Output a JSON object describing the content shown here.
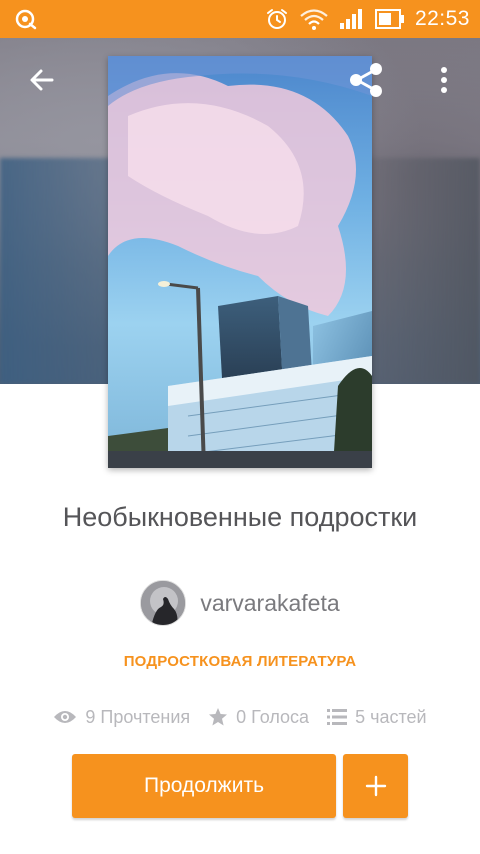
{
  "status_bar": {
    "time": "22:53",
    "icons": [
      "sync-icon",
      "alarm-icon",
      "wifi-icon",
      "signal-icon",
      "battery-icon"
    ],
    "color": "#f6921e"
  },
  "toolbar": {
    "icons": [
      "back-arrow-icon",
      "share-icon",
      "more-vert-icon"
    ]
  },
  "story": {
    "title": "Необыкновенные подростки",
    "author": "varvarakafeta",
    "category": "ПОДРОСТКОВАЯ ЛИТЕРАТУРА",
    "stats": {
      "reads": "9 Прочтения",
      "votes": "0 Голоса",
      "parts": "5 частей"
    }
  },
  "actions": {
    "continue_label": "Продолжить",
    "add_label": "+"
  },
  "colors": {
    "accent": "#f6921e",
    "title_text": "#555558",
    "muted_text": "#b8b8bc"
  }
}
